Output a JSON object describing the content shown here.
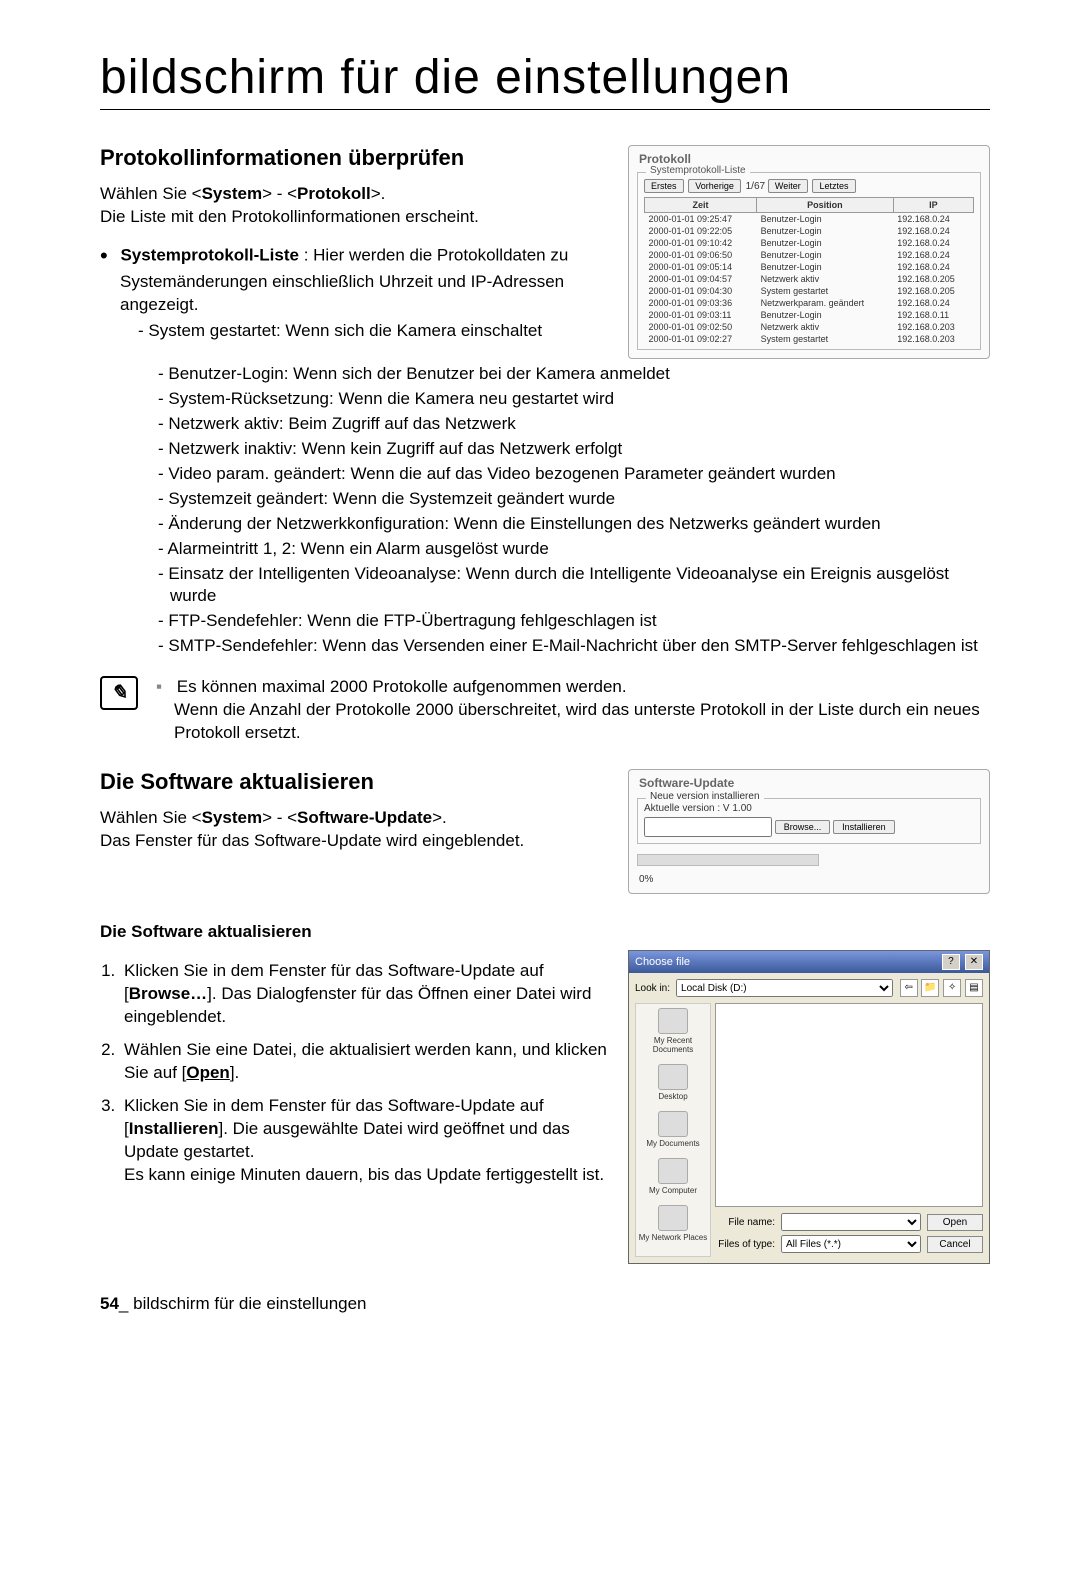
{
  "page_title": "bildschirm für die einstellungen",
  "section1": {
    "heading": "Protokollinformationen überprüfen",
    "intro_pre": "Wählen Sie <",
    "sys": "System",
    "intro_mid": "> - <",
    "proto": "Protokoll",
    "intro_post": ">.",
    "intro_line2": "Die Liste mit den Protokollinformationen erscheint.",
    "bullet_label": "Systemprotokoll-Liste",
    "bullet_text": " : Hier werden die Protokolldaten zu Systemänderungen einschließlich Uhrzeit und IP-Adressen angezeigt.",
    "dash_items": [
      "System gestartet: Wenn sich die Kamera einschaltet",
      "Benutzer-Login: Wenn sich der Benutzer bei der Kamera anmeldet",
      "System-Rücksetzung: Wenn die Kamera neu gestartet wird",
      "Netzwerk aktiv: Beim Zugriff auf das Netzwerk",
      "Netzwerk inaktiv: Wenn kein Zugriff auf das Netzwerk erfolgt",
      "Video param. geändert: Wenn die auf das Video bezogenen Parameter geändert wurden",
      "Systemzeit geändert: Wenn die Systemzeit geändert wurde",
      "Änderung der Netzwerkkonfiguration: Wenn die Einstellungen des Netzwerks geändert wurden",
      "Alarmeintritt 1, 2: Wenn ein Alarm ausgelöst wurde",
      "Einsatz der Intelligenten Videoanalyse: Wenn durch die Intelligente Videoanalyse ein Ereignis ausgelöst wurde",
      "FTP-Sendefehler: Wenn die FTP-Übertragung fehlgeschlagen ist",
      "SMTP-Sendefehler: Wenn das Versenden einer E-Mail-Nachricht über den SMTP-Server fehlgeschlagen ist"
    ]
  },
  "protokoll_panel": {
    "title": "Protokoll",
    "fieldset": "Systemprotokoll-Liste",
    "btn_first": "Erstes",
    "btn_prev": "Vorherige",
    "page_indicator": "1/67",
    "btn_next": "Weiter",
    "btn_last": "Letztes",
    "col_time": "Zeit",
    "col_pos": "Position",
    "col_ip": "IP",
    "rows": [
      {
        "t": "2000-01-01 09:25:47",
        "p": "Benutzer-Login",
        "ip": "192.168.0.24"
      },
      {
        "t": "2000-01-01 09:22:05",
        "p": "Benutzer-Login",
        "ip": "192.168.0.24"
      },
      {
        "t": "2000-01-01 09:10:42",
        "p": "Benutzer-Login",
        "ip": "192.168.0.24"
      },
      {
        "t": "2000-01-01 09:06:50",
        "p": "Benutzer-Login",
        "ip": "192.168.0.24"
      },
      {
        "t": "2000-01-01 09:05:14",
        "p": "Benutzer-Login",
        "ip": "192.168.0.24"
      },
      {
        "t": "2000-01-01 09:04:57",
        "p": "Netzwerk aktiv",
        "ip": "192.168.0.205"
      },
      {
        "t": "2000-01-01 09:04:30",
        "p": "System gestartet",
        "ip": "192.168.0.205"
      },
      {
        "t": "2000-01-01 09:03:36",
        "p": "Netzwerkparam. geändert",
        "ip": "192.168.0.24"
      },
      {
        "t": "2000-01-01 09:03:11",
        "p": "Benutzer-Login",
        "ip": "192.168.0.11"
      },
      {
        "t": "2000-01-01 09:02:50",
        "p": "Netzwerk aktiv",
        "ip": "192.168.0.203"
      },
      {
        "t": "2000-01-01 09:02:27",
        "p": "System gestartet",
        "ip": "192.168.0.203"
      }
    ]
  },
  "note": {
    "line1": "Es können maximal 2000 Protokolle aufgenommen werden.",
    "line2": "Wenn die Anzahl der Protokolle 2000 überschreitet, wird das unterste Protokoll in der Liste durch ein neues Protokoll ersetzt."
  },
  "section2": {
    "heading": "Die Software aktualisieren",
    "intro_pre": "Wählen Sie <",
    "sys": "System",
    "intro_mid": "> - <",
    "sw": "Software-Update",
    "intro_post": ">.",
    "intro_line2": "Das Fenster für das Software-Update wird eingeblendet."
  },
  "sw_panel": {
    "title": "Software-Update",
    "fieldset": "Neue version installieren",
    "current": "Aktuelle version : V 1.00",
    "btn_browse": "Browse...",
    "btn_install": "Installieren",
    "progress": "0%"
  },
  "section3": {
    "heading": "Die Software aktualisieren",
    "s1a": "Klicken Sie in dem Fenster für das Software-Update auf [",
    "s1b": "Browse…",
    "s1c": "]. Das Dialogfenster für das Öffnen einer Datei wird eingeblendet.",
    "s2a": "Wählen Sie eine Datei, die aktualisiert werden kann, und klicken Sie auf [",
    "s2b": "Open",
    "s2c": "].",
    "s3a": "Klicken Sie in dem Fenster für das Software-Update auf [",
    "s3b": "Installieren",
    "s3c": "]. Die ausgewählte Datei wird geöffnet und das Update gestartet.",
    "s3d": "Es kann einige Minuten dauern, bis das Update fertiggestellt ist."
  },
  "dialog": {
    "title": "Choose file",
    "lookin_label": "Look in:",
    "lookin_value": "Local Disk (D:)",
    "places": [
      "My Recent Documents",
      "Desktop",
      "My Documents",
      "My Computer",
      "My Network Places"
    ],
    "filename_label": "File name:",
    "filetype_label": "Files of type:",
    "filetype_value": "All Files (*.*)",
    "btn_open": "Open",
    "btn_cancel": "Cancel"
  },
  "footer": {
    "page_num": "54",
    "sep": "_ ",
    "text": "bildschirm für die einstellungen"
  }
}
